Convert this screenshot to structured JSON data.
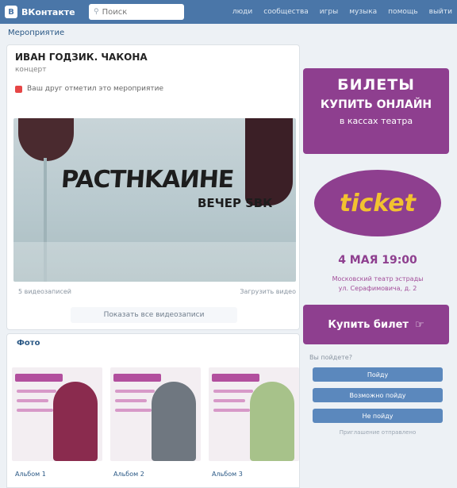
{
  "header": {
    "logo_text": "ВКонтакте",
    "logo_mark": "В",
    "search_placeholder": "Поиск",
    "nav": [
      "люди",
      "сообщества",
      "игры",
      "музыка",
      "помощь",
      "выйти"
    ]
  },
  "breadcrumb": "Мероприятие",
  "event": {
    "title": "ИВАН ГОДЗИК. ЧАКОНА",
    "subtitle": "концерт",
    "note": "Ваш друг отметил это мероприятие"
  },
  "video": {
    "caption": "PACTHKAИHE",
    "caption2": "ВЕЧЕР 5ВК",
    "meta_left": "5 видеозаписей",
    "meta_right": "Загрузить видео"
  },
  "more_button": "Показать все видеозаписи",
  "photos": {
    "heading": "Фото",
    "labels": [
      "Альбом 1",
      "Альбом 2",
      "Альбом 3"
    ]
  },
  "sidebar": {
    "ad_line1": "БИЛЕТЫ",
    "ad_line2": "КУПИТЬ ОНЛАЙН",
    "ad_line3": "в кассах театра",
    "logo_text": "ticket",
    "date": "4 МАЯ 19:00",
    "info_line1": "Московский театр эстрады",
    "info_line2": "ул. Серафимовича, д. 2",
    "ticket_button": "Купить билет",
    "text": "Вы пойдете?",
    "buttons": [
      "Пойду",
      "Возможно пойду",
      "Не пойду"
    ],
    "footer": "Приглашение отправлено"
  },
  "colors": {
    "nav": "#4a76a8",
    "brand_purple": "#8e3f8f",
    "brand_yellow": "#f2c230",
    "link": "#2a5885"
  }
}
